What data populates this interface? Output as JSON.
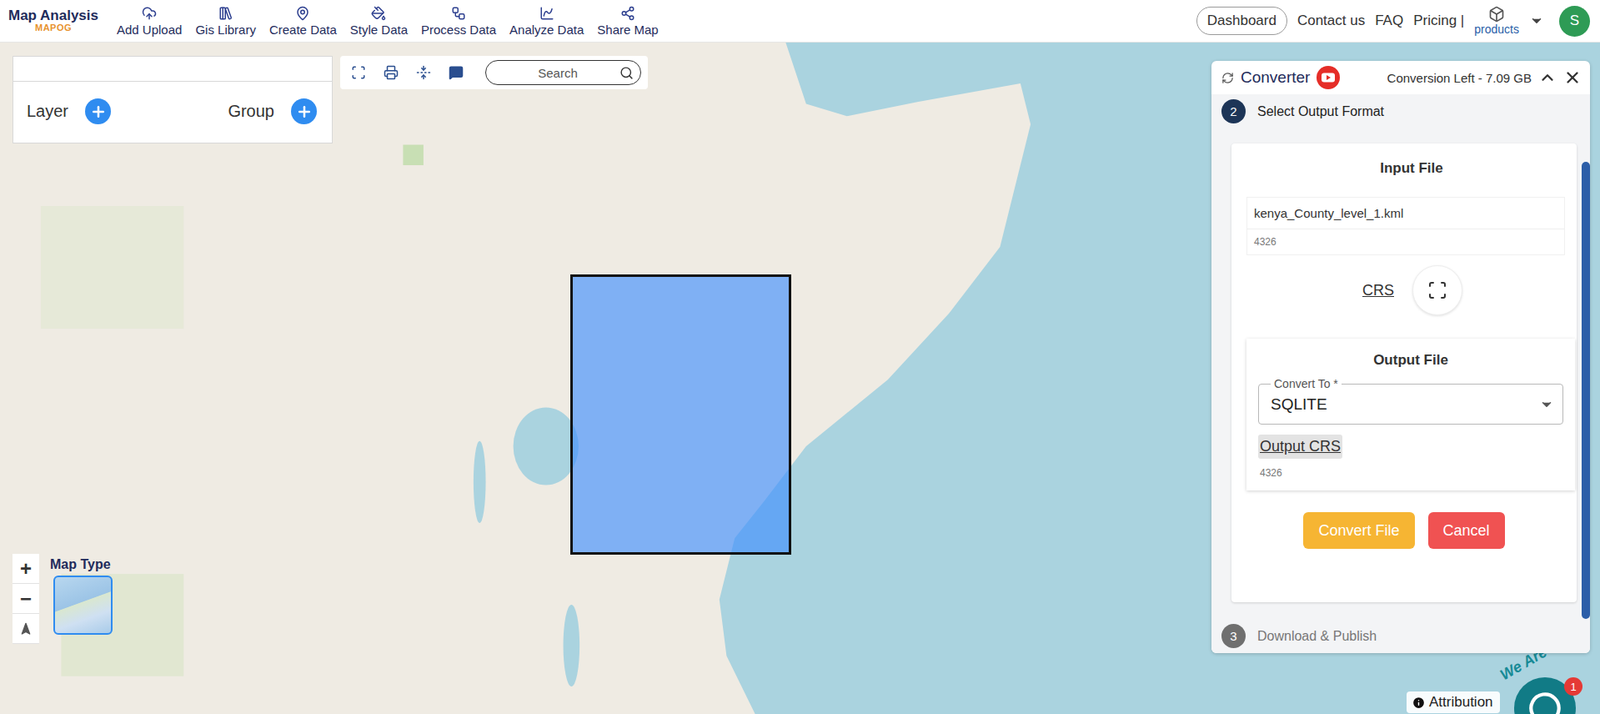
{
  "logo": {
    "title": "Map Analysis",
    "subtitle": "MAPOG"
  },
  "nav": [
    {
      "label": "Add Upload"
    },
    {
      "label": "Gis Library"
    },
    {
      "label": "Create Data"
    },
    {
      "label": "Style Data"
    },
    {
      "label": "Process Data"
    },
    {
      "label": "Analyze Data"
    },
    {
      "label": "Share Map"
    }
  ],
  "account": {
    "dashboard": "Dashboard",
    "links": [
      "Contact us",
      "FAQ",
      "Pricing |"
    ],
    "products": "products",
    "avatar": "S"
  },
  "layers_panel": {
    "layer": "Layer",
    "group": "Group"
  },
  "map_toolbar": {
    "search_placeholder": "Search"
  },
  "map_controls": {
    "zoom_in": "+",
    "zoom_out": "−",
    "map_type": "Map Type",
    "attribution": "Attribution"
  },
  "chat": {
    "tagline": "We Are Here",
    "badge": "1"
  },
  "converter": {
    "title": "Converter",
    "quota": "Conversion Left - 7.09 GB",
    "steps": [
      {
        "number": "2",
        "label": "Select Output Format",
        "active": true
      },
      {
        "number": "3",
        "label": "Download & Publish",
        "active": false
      }
    ],
    "input": {
      "heading": "Input File",
      "file_name": "kenya_County_level_1.kml",
      "crs_code": "4326",
      "crs_link": "CRS"
    },
    "output": {
      "heading": "Output File",
      "convert_to_label": "Convert To *",
      "convert_to_value": "SQLITE",
      "crs_link": "Output CRS",
      "crs_link_hovered": true,
      "crs_code": "4326"
    },
    "buttons": [
      {
        "label": "Convert File",
        "color": "#f6b533"
      },
      {
        "label": "Cancel",
        "color": "#f05252"
      }
    ]
  }
}
